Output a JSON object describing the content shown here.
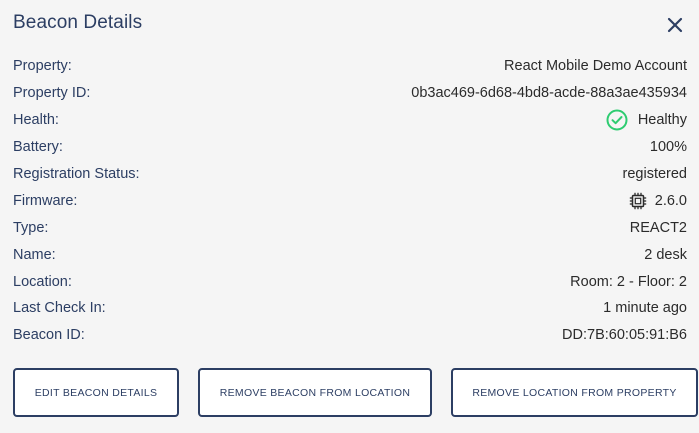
{
  "header": {
    "title": "Beacon Details"
  },
  "details": [
    {
      "label": "Property:",
      "value": "React Mobile Demo Account"
    },
    {
      "label": "Property ID:",
      "value": "0b3ac469-6d68-4bd8-acde-88a3ae435934"
    },
    {
      "label": "Health:",
      "value": "Healthy",
      "icon": "check-circle-icon"
    },
    {
      "label": "Battery:",
      "value": "100%"
    },
    {
      "label": "Registration Status:",
      "value": "registered"
    },
    {
      "label": "Firmware:",
      "value": "2.6.0",
      "icon": "chip-icon"
    },
    {
      "label": "Type:",
      "value": "REACT2"
    },
    {
      "label": "Name:",
      "value": "2 desk"
    },
    {
      "label": "Location:",
      "value": "Room: 2 - Floor: 2"
    },
    {
      "label": "Last Check In:",
      "value": "1 minute ago"
    },
    {
      "label": "Beacon ID:",
      "value": "DD:7B:60:05:91:B6"
    }
  ],
  "buttons": {
    "edit": "EDIT BEACON DETAILS",
    "remove_beacon": "REMOVE BEACON FROM LOCATION",
    "remove_location": "REMOVE LOCATION FROM PROPERTY"
  },
  "colors": {
    "accent": "#2c3e63",
    "healthy": "#2ecc71",
    "background": "#f5f5f5"
  }
}
